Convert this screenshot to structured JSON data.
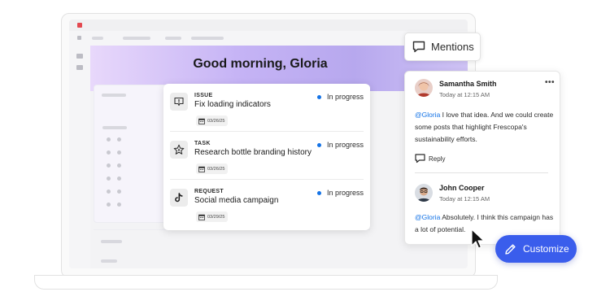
{
  "greeting": "Good morning, Gloria",
  "work_items": [
    {
      "type": "ISSUE",
      "icon": "alert-icon",
      "title": "Fix loading indicators",
      "date": "03/26/25",
      "status": "In progress"
    },
    {
      "type": "TASK",
      "icon": "star-icon",
      "title": "Research bottle branding history",
      "date": "03/26/25",
      "status": "In progress"
    },
    {
      "type": "REQUEST",
      "icon": "tiktok-icon",
      "title": "Social media campaign",
      "date": "03/29/25",
      "status": "In progress"
    }
  ],
  "mentions": {
    "label": "Mentions"
  },
  "comments": [
    {
      "author": "Samantha Smith",
      "time": "Today at 12:15 AM",
      "mention": "@Gloria",
      "text": " I love that idea. And we could create some posts that highlight Frescopa's sustainability efforts.",
      "reply_label": "Reply"
    },
    {
      "author": "John Cooper",
      "time": "Today at 12:15 AM",
      "mention": "@Gloria",
      "text": " Absolutely. I think this campaign has a lot of potential."
    }
  ],
  "customize": {
    "label": "Customize"
  },
  "colors": {
    "accent": "#3a5dec",
    "link": "#1473e6",
    "status_dot": "#1473e6"
  }
}
